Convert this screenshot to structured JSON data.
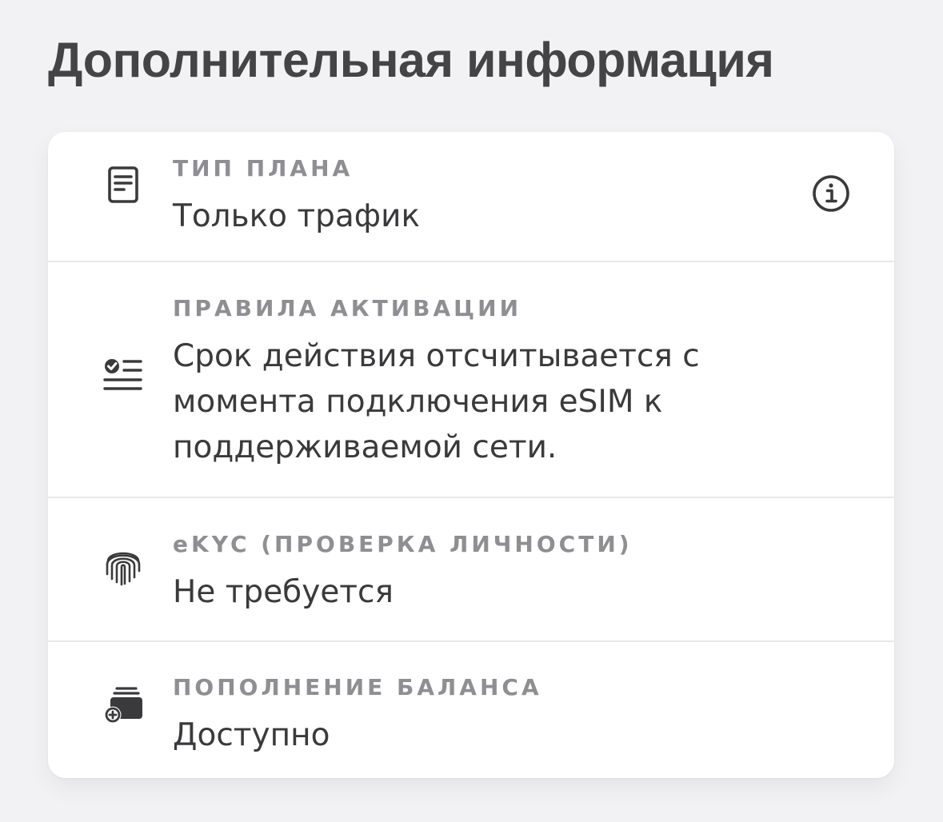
{
  "section": {
    "title": "Дополнительная информация"
  },
  "rows": [
    {
      "icon": "document-icon",
      "label": "ТИП ПЛАНА",
      "value": "Только трафик",
      "action_icon": "info-icon"
    },
    {
      "icon": "checklist-icon",
      "label": "ПРАВИЛА АКТИВАЦИИ",
      "value": "Срок действия отсчитывается с момента подключения eSIM к поддерживаемой сети."
    },
    {
      "icon": "fingerprint-icon",
      "label": "eKYC (ПРОВЕРКА ЛИЧНОСТИ)",
      "value": "Не требуется"
    },
    {
      "icon": "add-card-icon",
      "label": "ПОПОЛНЕНИЕ БАЛАНСА",
      "value": "Доступно"
    }
  ],
  "colors": {
    "background": "#f2f2f4",
    "card": "#ffffff",
    "label": "#8e8e93",
    "text": "#3a3a3c",
    "divider": "#e8e8ea"
  }
}
